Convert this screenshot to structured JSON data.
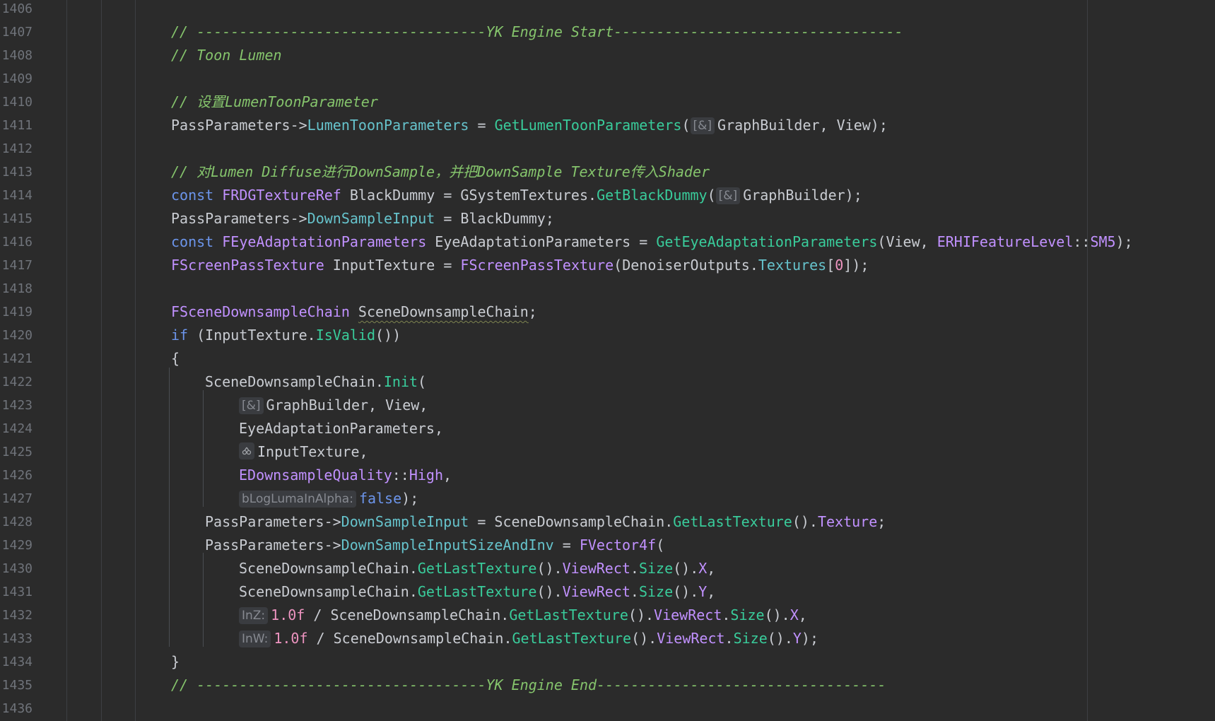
{
  "colors": {
    "background": "#2b2b2b",
    "line_number": "#6f737a",
    "keyword": "#6c95eb",
    "type": "#c191ff",
    "function": "#39cc9b",
    "field": "#66c3cc",
    "number": "#ed94c0",
    "comment": "#85c46c",
    "plain": "#c9ccd2",
    "inlay_hint_bg": "#3a3c40"
  },
  "icons": {
    "ref_hint": "[&]",
    "move_hint_icon": "clone-icon"
  },
  "lines": [
    {
      "n": "1406",
      "indent": 0,
      "tokens": []
    },
    {
      "n": "1407",
      "indent": 1,
      "tokens": [
        {
          "t": "// ----------------------------------YK Engine Start----------------------------------",
          "c": "cm"
        }
      ]
    },
    {
      "n": "1408",
      "indent": 1,
      "tokens": [
        {
          "t": "// Toon Lumen",
          "c": "cm"
        }
      ]
    },
    {
      "n": "1409",
      "indent": 0,
      "tokens": []
    },
    {
      "n": "1410",
      "indent": 1,
      "tokens": [
        {
          "t": "// 设置LumenToonParameter",
          "c": "cm"
        }
      ]
    },
    {
      "n": "1411",
      "indent": 1,
      "tokens": [
        {
          "t": "PassParameters->",
          "c": "pl"
        },
        {
          "t": "LumenToonParameters",
          "c": "fld"
        },
        {
          "t": " = ",
          "c": "pl"
        },
        {
          "t": "GetLumenToonParameters",
          "c": "fn"
        },
        {
          "t": "(",
          "c": "pl"
        },
        {
          "t": "[&]",
          "c": "hint"
        },
        {
          "t": "GraphBuilder, View);",
          "c": "pl"
        }
      ]
    },
    {
      "n": "1412",
      "indent": 0,
      "tokens": []
    },
    {
      "n": "1413",
      "indent": 1,
      "tokens": [
        {
          "t": "// 对Lumen Diffuse进行DownSample，并把DownSample Texture传入Shader",
          "c": "cm"
        }
      ]
    },
    {
      "n": "1414",
      "indent": 1,
      "tokens": [
        {
          "t": "const ",
          "c": "kw"
        },
        {
          "t": "FRDGTextureRef",
          "c": "ty"
        },
        {
          "t": " BlackDummy = GSystemTextures.",
          "c": "pl"
        },
        {
          "t": "GetBlackDummy",
          "c": "fn"
        },
        {
          "t": "(",
          "c": "pl"
        },
        {
          "t": "[&]",
          "c": "hint"
        },
        {
          "t": "GraphBuilder);",
          "c": "pl"
        }
      ]
    },
    {
      "n": "1415",
      "indent": 1,
      "tokens": [
        {
          "t": "PassParameters->",
          "c": "pl"
        },
        {
          "t": "DownSampleInput",
          "c": "fld"
        },
        {
          "t": " = BlackDummy;",
          "c": "pl"
        }
      ]
    },
    {
      "n": "1416",
      "indent": 1,
      "tokens": [
        {
          "t": "const ",
          "c": "kw"
        },
        {
          "t": "FEyeAdaptationParameters",
          "c": "ty"
        },
        {
          "t": " EyeAdaptationParameters = ",
          "c": "pl"
        },
        {
          "t": "GetEyeAdaptationParameters",
          "c": "fn"
        },
        {
          "t": "(View, ",
          "c": "pl"
        },
        {
          "t": "ERHIFeatureLevel",
          "c": "ty"
        },
        {
          "t": "::",
          "c": "pl"
        },
        {
          "t": "SM5",
          "c": "enm"
        },
        {
          "t": ");",
          "c": "pl"
        }
      ]
    },
    {
      "n": "1417",
      "indent": 1,
      "tokens": [
        {
          "t": "FScreenPassTexture",
          "c": "ty"
        },
        {
          "t": " InputTexture = ",
          "c": "pl"
        },
        {
          "t": "FScreenPassTexture",
          "c": "ty"
        },
        {
          "t": "(DenoiserOutputs.",
          "c": "pl"
        },
        {
          "t": "Textures",
          "c": "fld"
        },
        {
          "t": "[",
          "c": "pl"
        },
        {
          "t": "0",
          "c": "num"
        },
        {
          "t": "]);",
          "c": "pl"
        }
      ]
    },
    {
      "n": "1418",
      "indent": 0,
      "tokens": []
    },
    {
      "n": "1419",
      "indent": 1,
      "tokens": [
        {
          "t": "FSceneDownsampleChain",
          "c": "ty"
        },
        {
          "t": " ",
          "c": "pl"
        },
        {
          "t": "SceneDownsampleChain",
          "c": "warn"
        },
        {
          "t": ";",
          "c": "pl"
        }
      ]
    },
    {
      "n": "1420",
      "indent": 1,
      "tokens": [
        {
          "t": "if",
          "c": "kw"
        },
        {
          "t": " (InputTexture.",
          "c": "pl"
        },
        {
          "t": "IsValid",
          "c": "fn"
        },
        {
          "t": "())",
          "c": "pl"
        }
      ]
    },
    {
      "n": "1421",
      "indent": 1,
      "tokens": [
        {
          "t": "{",
          "c": "pl"
        }
      ]
    },
    {
      "n": "1422",
      "indent": 2,
      "tokens": [
        {
          "t": "SceneDownsampleChain.",
          "c": "pl"
        },
        {
          "t": "Init",
          "c": "fn"
        },
        {
          "t": "(",
          "c": "pl"
        }
      ]
    },
    {
      "n": "1423",
      "indent": 3,
      "tokens": [
        {
          "t": "[&]",
          "c": "hint"
        },
        {
          "t": "GraphBuilder, View,",
          "c": "pl"
        }
      ]
    },
    {
      "n": "1424",
      "indent": 3,
      "tokens": [
        {
          "t": "EyeAdaptationParameters,",
          "c": "pl"
        }
      ]
    },
    {
      "n": "1425",
      "indent": 3,
      "tokens": [
        {
          "t": "",
          "c": "icon"
        },
        {
          "t": "InputTexture,",
          "c": "pl"
        }
      ]
    },
    {
      "n": "1426",
      "indent": 3,
      "tokens": [
        {
          "t": "EDownsampleQuality",
          "c": "ty"
        },
        {
          "t": "::",
          "c": "pl"
        },
        {
          "t": "High",
          "c": "enm"
        },
        {
          "t": ",",
          "c": "pl"
        }
      ]
    },
    {
      "n": "1427",
      "indent": 3,
      "tokens": [
        {
          "t": "bLogLumaInAlpha:",
          "c": "hint"
        },
        {
          "t": "false",
          "c": "kw"
        },
        {
          "t": ");",
          "c": "pl"
        }
      ]
    },
    {
      "n": "1428",
      "indent": 2,
      "tokens": [
        {
          "t": "PassParameters->",
          "c": "pl"
        },
        {
          "t": "DownSampleInput",
          "c": "fld"
        },
        {
          "t": " = SceneDownsampleChain.",
          "c": "pl"
        },
        {
          "t": "GetLastTexture",
          "c": "fn"
        },
        {
          "t": "().",
          "c": "pl"
        },
        {
          "t": "Texture",
          "c": "enm"
        },
        {
          "t": ";",
          "c": "pl"
        }
      ]
    },
    {
      "n": "1429",
      "indent": 2,
      "tokens": [
        {
          "t": "PassParameters->",
          "c": "pl"
        },
        {
          "t": "DownSampleInputSizeAndInv",
          "c": "fld"
        },
        {
          "t": " = ",
          "c": "pl"
        },
        {
          "t": "FVector4f",
          "c": "ty"
        },
        {
          "t": "(",
          "c": "pl"
        }
      ]
    },
    {
      "n": "1430",
      "indent": 3,
      "tokens": [
        {
          "t": "SceneDownsampleChain.",
          "c": "pl"
        },
        {
          "t": "GetLastTexture",
          "c": "fn"
        },
        {
          "t": "().",
          "c": "pl"
        },
        {
          "t": "ViewRect",
          "c": "enm"
        },
        {
          "t": ".",
          "c": "pl"
        },
        {
          "t": "Size",
          "c": "fn"
        },
        {
          "t": "().",
          "c": "pl"
        },
        {
          "t": "X",
          "c": "enm"
        },
        {
          "t": ",",
          "c": "pl"
        }
      ]
    },
    {
      "n": "1431",
      "indent": 3,
      "tokens": [
        {
          "t": "SceneDownsampleChain.",
          "c": "pl"
        },
        {
          "t": "GetLastTexture",
          "c": "fn"
        },
        {
          "t": "().",
          "c": "pl"
        },
        {
          "t": "ViewRect",
          "c": "enm"
        },
        {
          "t": ".",
          "c": "pl"
        },
        {
          "t": "Size",
          "c": "fn"
        },
        {
          "t": "().",
          "c": "pl"
        },
        {
          "t": "Y",
          "c": "enm"
        },
        {
          "t": ",",
          "c": "pl"
        }
      ]
    },
    {
      "n": "1432",
      "indent": 3,
      "tokens": [
        {
          "t": "InZ:",
          "c": "hint"
        },
        {
          "t": "1.0f",
          "c": "num"
        },
        {
          "t": " / SceneDownsampleChain.",
          "c": "pl"
        },
        {
          "t": "GetLastTexture",
          "c": "fn"
        },
        {
          "t": "().",
          "c": "pl"
        },
        {
          "t": "ViewRect",
          "c": "enm"
        },
        {
          "t": ".",
          "c": "pl"
        },
        {
          "t": "Size",
          "c": "fn"
        },
        {
          "t": "().",
          "c": "pl"
        },
        {
          "t": "X",
          "c": "enm"
        },
        {
          "t": ",",
          "c": "pl"
        }
      ]
    },
    {
      "n": "1433",
      "indent": 3,
      "tokens": [
        {
          "t": "InW:",
          "c": "hint"
        },
        {
          "t": "1.0f",
          "c": "num"
        },
        {
          "t": " / SceneDownsampleChain.",
          "c": "pl"
        },
        {
          "t": "GetLastTexture",
          "c": "fn"
        },
        {
          "t": "().",
          "c": "pl"
        },
        {
          "t": "ViewRect",
          "c": "enm"
        },
        {
          "t": ".",
          "c": "pl"
        },
        {
          "t": "Size",
          "c": "fn"
        },
        {
          "t": "().",
          "c": "pl"
        },
        {
          "t": "Y",
          "c": "enm"
        },
        {
          "t": ");",
          "c": "pl"
        }
      ]
    },
    {
      "n": "1434",
      "indent": 1,
      "tokens": [
        {
          "t": "}",
          "c": "pl"
        }
      ]
    },
    {
      "n": "1435",
      "indent": 1,
      "tokens": [
        {
          "t": "// ----------------------------------YK Engine End----------------------------------",
          "c": "cm"
        }
      ]
    },
    {
      "n": "1436",
      "indent": 0,
      "tokens": []
    }
  ]
}
